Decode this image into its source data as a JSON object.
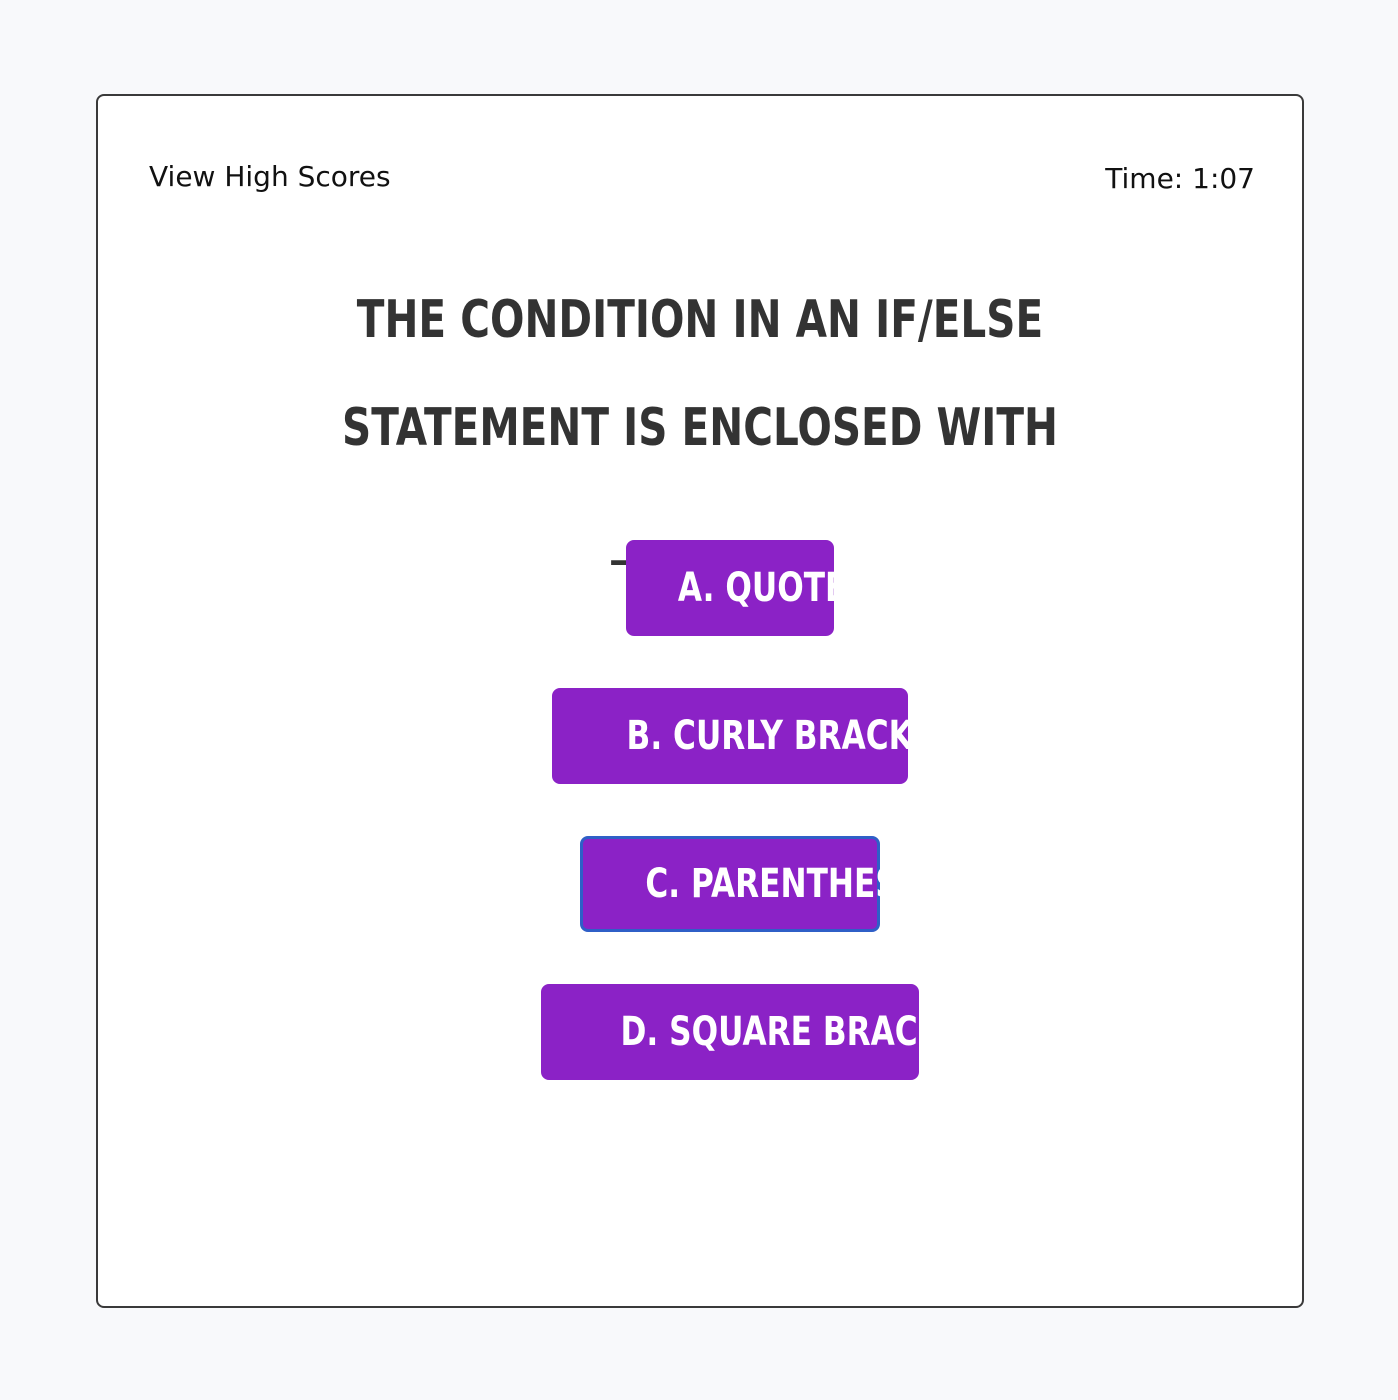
{
  "header": {
    "high_scores_label": "View High Scores",
    "timer_label": "Time: 1:07"
  },
  "question": {
    "text": "The condition in an if/else statement is enclosed with ________."
  },
  "answers": [
    {
      "label": "A. Quotes"
    },
    {
      "label": "B. Curly Brackets"
    },
    {
      "label": "C. Parenthesis",
      "focused": true
    },
    {
      "label": "D. Square Brackets"
    }
  ],
  "colors": {
    "button_bg": "#8b22c6",
    "focus_ring": "#2f5fc7",
    "heading_text": "#333333"
  }
}
